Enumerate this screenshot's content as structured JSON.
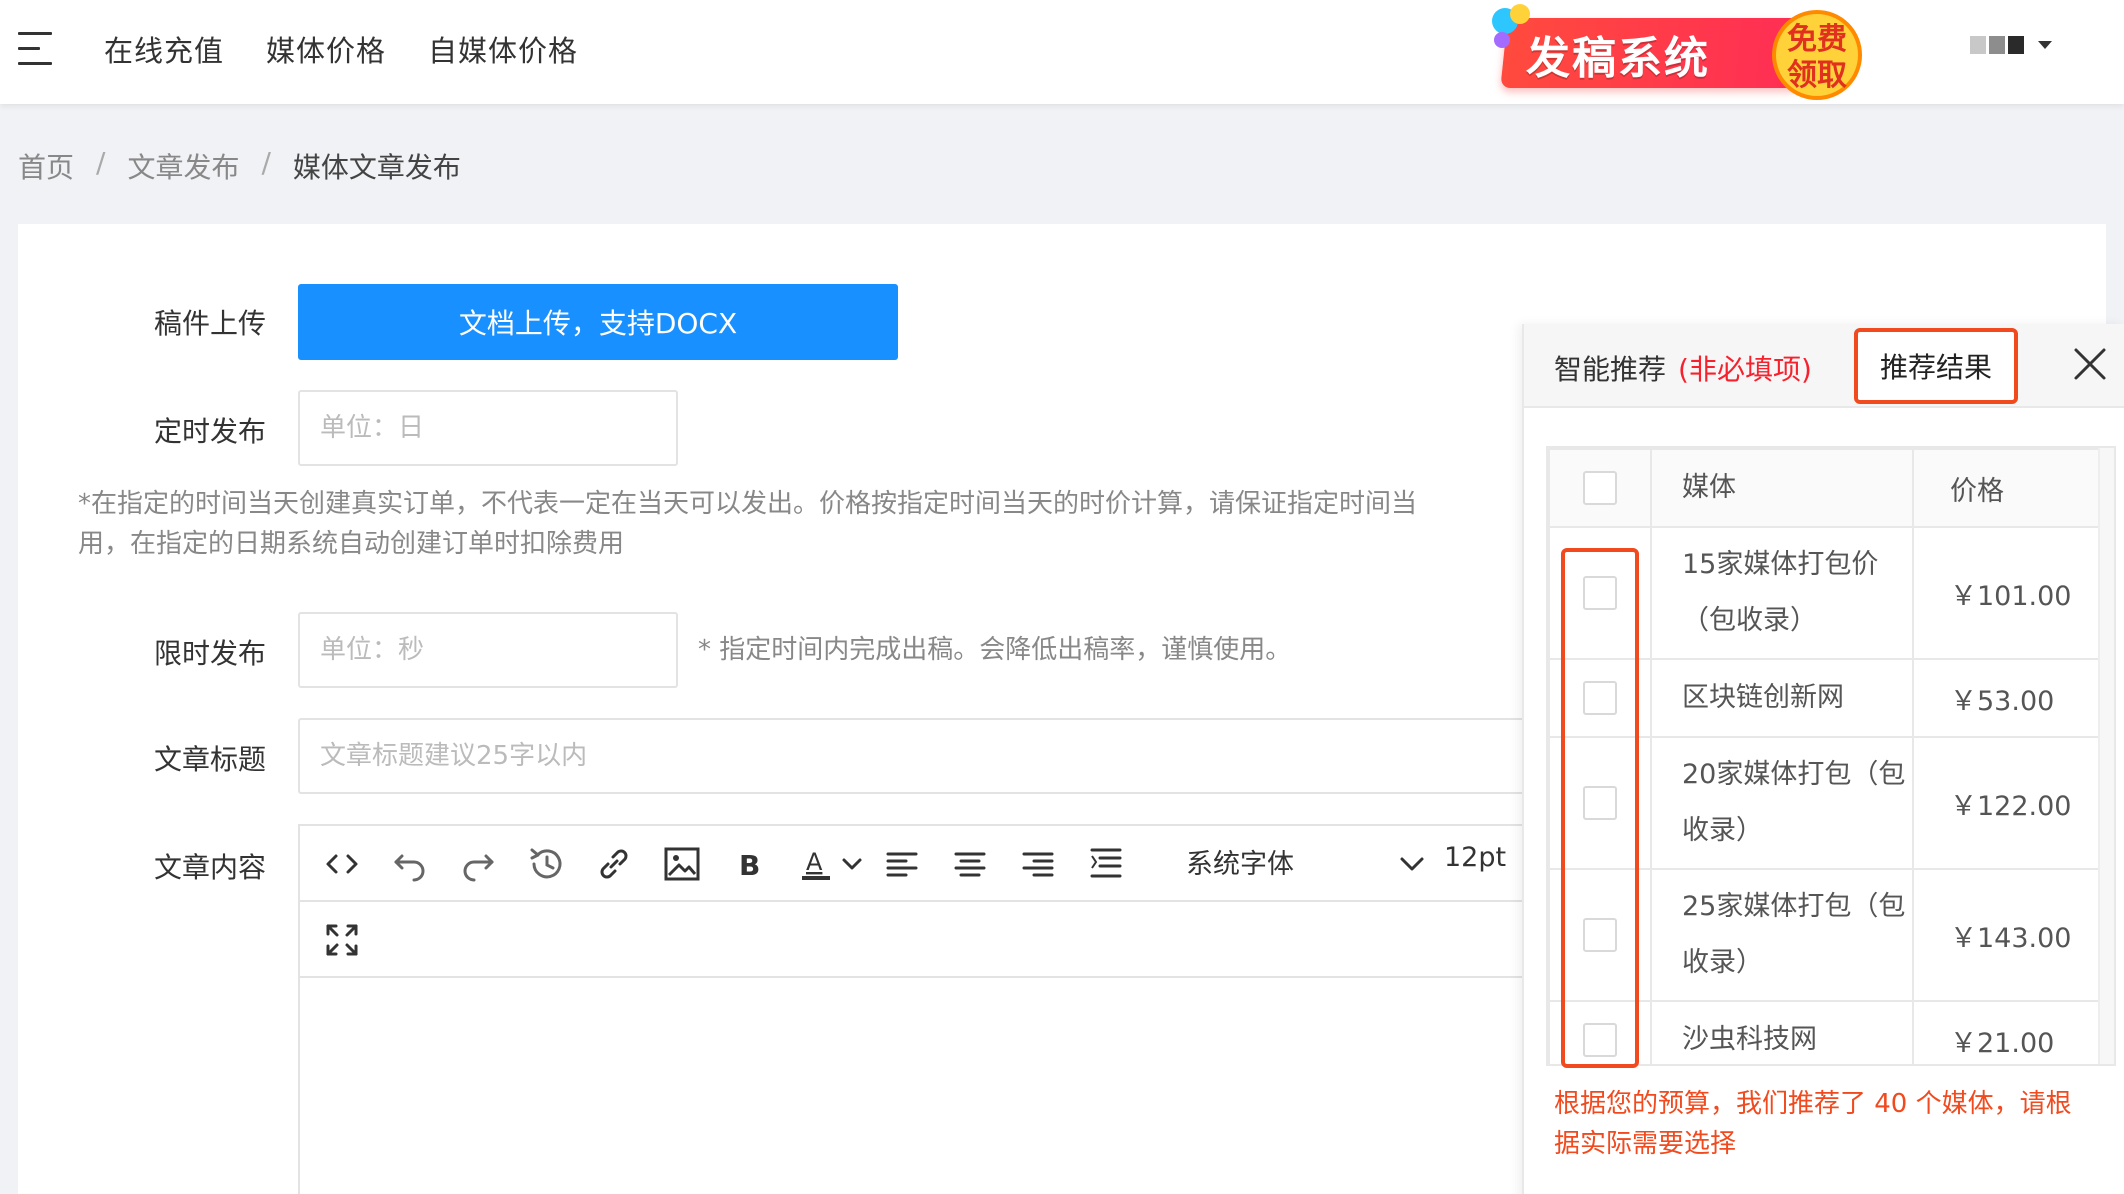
{
  "topnav": {
    "items": [
      {
        "label": "在线充值"
      },
      {
        "label": "媒体价格"
      },
      {
        "label": "自媒体价格"
      }
    ]
  },
  "promo": {
    "text": "发稿系统",
    "badge_line1": "免费",
    "badge_line2": "领取"
  },
  "breadcrumb": {
    "items": [
      "首页",
      "文章发布",
      "媒体文章发布"
    ],
    "separator": "/"
  },
  "form": {
    "upload": {
      "label": "稿件上传",
      "button": "文档上传，支持DOCX"
    },
    "schedule": {
      "label": "定时发布",
      "placeholder": "单位：日",
      "note_line1": "*在指定的时间当天创建真实订单，不代表一定在当天可以发出。价格按指定时间当天的时价计算，请保证指定时间当",
      "note_line2": "用，在指定的日期系统自动创建订单时扣除费用"
    },
    "limit": {
      "label": "限时发布",
      "placeholder": "单位：秒",
      "note": "* 指定时间内完成出稿。会降低出稿率，谨慎使用。"
    },
    "title": {
      "label": "文章标题",
      "placeholder": "文章标题建议25字以内"
    },
    "content": {
      "label": "文章内容",
      "font_family": "系统字体",
      "font_size": "12pt"
    }
  },
  "panel": {
    "tab_smart": "智能推荐",
    "tab_smart_optional": "(非必填项)",
    "tab_result": "推荐结果",
    "table": {
      "headers": [
        "媒体",
        "价格"
      ],
      "rows": [
        {
          "media": "15家媒体打包价（包收录）",
          "price": "￥101.00"
        },
        {
          "media": "区块链创新网",
          "price": "￥53.00"
        },
        {
          "media": "20家媒体打包（包收录）",
          "price": "￥122.00"
        },
        {
          "media": "25家媒体打包（包收录）",
          "price": "￥143.00"
        },
        {
          "media": "沙虫科技网",
          "price": "￥21.00"
        }
      ]
    },
    "message": "根据您的预算，我们推荐了 40 个媒体，请根据实际需要选择"
  },
  "colors": {
    "primary": "#1890ff",
    "highlight": "#f04a1e",
    "optional_red": "#f5222d"
  }
}
